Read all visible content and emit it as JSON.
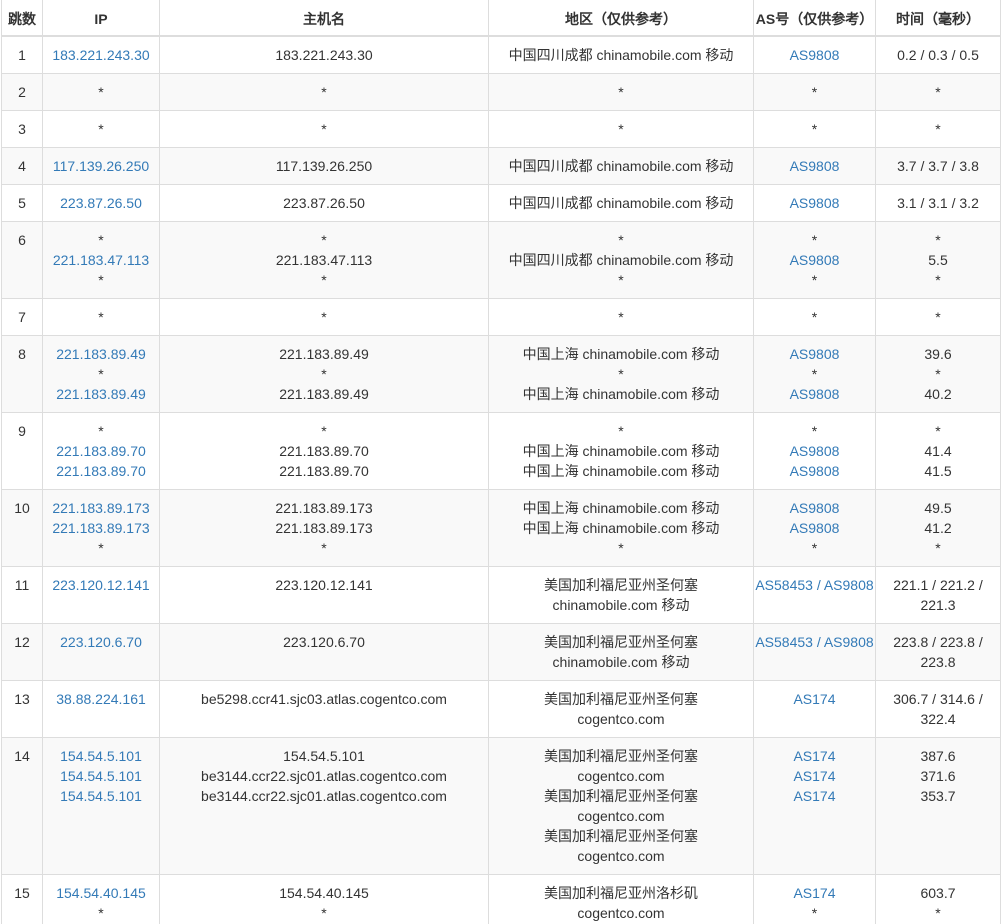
{
  "colors": {
    "link": "#337ab7",
    "text": "#333333",
    "border": "#dddddd",
    "stripe": "#f9f9f9"
  },
  "headers": {
    "hop": "跳数",
    "ip": "IP",
    "host": "主机名",
    "region": "地区（仅供参考）",
    "as": "AS号（仅供参考）",
    "time": "时间（毫秒）"
  },
  "rows": [
    {
      "hop": "1",
      "ip": [
        "183.221.243.30"
      ],
      "host": [
        "183.221.243.30"
      ],
      "region": [
        "中国四川成都 chinamobile.com 移动"
      ],
      "as": [
        "AS9808"
      ],
      "time": [
        "0.2 / 0.3 / 0.5"
      ]
    },
    {
      "hop": "2",
      "ip": [
        "*"
      ],
      "host": [
        "*"
      ],
      "region": [
        "*"
      ],
      "as": [
        "*"
      ],
      "time": [
        "*"
      ]
    },
    {
      "hop": "3",
      "ip": [
        "*"
      ],
      "host": [
        "*"
      ],
      "region": [
        "*"
      ],
      "as": [
        "*"
      ],
      "time": [
        "*"
      ]
    },
    {
      "hop": "4",
      "ip": [
        "117.139.26.250"
      ],
      "host": [
        "117.139.26.250"
      ],
      "region": [
        "中国四川成都 chinamobile.com 移动"
      ],
      "as": [
        "AS9808"
      ],
      "time": [
        "3.7 / 3.7 / 3.8"
      ]
    },
    {
      "hop": "5",
      "ip": [
        "223.87.26.50"
      ],
      "host": [
        "223.87.26.50"
      ],
      "region": [
        "中国四川成都 chinamobile.com 移动"
      ],
      "as": [
        "AS9808"
      ],
      "time": [
        "3.1 / 3.1 / 3.2"
      ]
    },
    {
      "hop": "6",
      "ip": [
        "*",
        "221.183.47.113",
        "*"
      ],
      "host": [
        "*",
        "221.183.47.113",
        "*"
      ],
      "region": [
        "*",
        "中国四川成都 chinamobile.com 移动",
        "*"
      ],
      "as": [
        "*",
        "AS9808",
        "*"
      ],
      "time": [
        "*",
        "5.5",
        "*"
      ]
    },
    {
      "hop": "7",
      "ip": [
        "*"
      ],
      "host": [
        "*"
      ],
      "region": [
        "*"
      ],
      "as": [
        "*"
      ],
      "time": [
        "*"
      ]
    },
    {
      "hop": "8",
      "ip": [
        "221.183.89.49",
        "*",
        "221.183.89.49"
      ],
      "host": [
        "221.183.89.49",
        "*",
        "221.183.89.49"
      ],
      "region": [
        "中国上海 chinamobile.com 移动",
        "*",
        "中国上海 chinamobile.com 移动"
      ],
      "as": [
        "AS9808",
        "*",
        "AS9808"
      ],
      "time": [
        "39.6",
        "*",
        "40.2"
      ]
    },
    {
      "hop": "9",
      "ip": [
        "*",
        "221.183.89.70",
        "221.183.89.70"
      ],
      "host": [
        "*",
        "221.183.89.70",
        "221.183.89.70"
      ],
      "region": [
        "*",
        "中国上海 chinamobile.com 移动",
        "中国上海 chinamobile.com 移动"
      ],
      "as": [
        "*",
        "AS9808",
        "AS9808"
      ],
      "time": [
        "*",
        "41.4",
        "41.5"
      ]
    },
    {
      "hop": "10",
      "ip": [
        "221.183.89.173",
        "221.183.89.173",
        "*"
      ],
      "host": [
        "221.183.89.173",
        "221.183.89.173",
        "*"
      ],
      "region": [
        "中国上海 chinamobile.com 移动",
        "中国上海 chinamobile.com 移动",
        "*"
      ],
      "as": [
        "AS9808",
        "AS9808",
        "*"
      ],
      "time": [
        "49.5",
        "41.2",
        "*"
      ]
    },
    {
      "hop": "11",
      "ip": [
        "223.120.12.141"
      ],
      "host": [
        "223.120.12.141"
      ],
      "region": [
        "美国加利福尼亚州圣何塞",
        "chinamobile.com 移动"
      ],
      "as": [
        "AS58453 / AS9808"
      ],
      "time": [
        "221.1 / 221.2 / 221.3"
      ]
    },
    {
      "hop": "12",
      "ip": [
        "223.120.6.70"
      ],
      "host": [
        "223.120.6.70"
      ],
      "region": [
        "美国加利福尼亚州圣何塞",
        "chinamobile.com 移动"
      ],
      "as": [
        "AS58453 / AS9808"
      ],
      "time": [
        "223.8 / 223.8 / 223.8"
      ]
    },
    {
      "hop": "13",
      "ip": [
        "38.88.224.161"
      ],
      "host": [
        "be5298.ccr41.sjc03.atlas.cogentco.com"
      ],
      "region": [
        "美国加利福尼亚州圣何塞",
        "cogentco.com"
      ],
      "as": [
        "AS174"
      ],
      "time": [
        "306.7 / 314.6 / 322.4"
      ]
    },
    {
      "hop": "14",
      "ip": [
        "154.54.5.101",
        "154.54.5.101",
        "154.54.5.101"
      ],
      "host": [
        "154.54.5.101",
        "be3144.ccr22.sjc01.atlas.cogentco.com",
        "be3144.ccr22.sjc01.atlas.cogentco.com"
      ],
      "region": [
        "美国加利福尼亚州圣何塞",
        "cogentco.com",
        "美国加利福尼亚州圣何塞",
        "cogentco.com",
        "美国加利福尼亚州圣何塞",
        "cogentco.com"
      ],
      "as": [
        "AS174",
        "AS174",
        "AS174"
      ],
      "time": [
        "387.6",
        "371.6",
        "353.7"
      ]
    },
    {
      "hop": "15",
      "ip": [
        "154.54.40.145",
        "*"
      ],
      "host": [
        "154.54.40.145",
        "*"
      ],
      "region": [
        "美国加利福尼亚州洛杉矶",
        "cogentco.com"
      ],
      "as": [
        "AS174",
        "*"
      ],
      "time": [
        "603.7",
        "*"
      ]
    }
  ]
}
